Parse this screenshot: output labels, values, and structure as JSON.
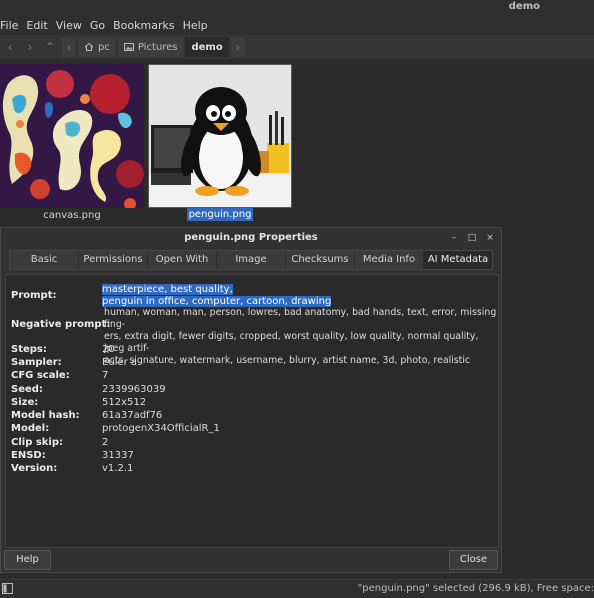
{
  "window": {
    "title": "demo"
  },
  "menubar": {
    "items": [
      "File",
      "Edit",
      "View",
      "Go",
      "Bookmarks",
      "Help"
    ]
  },
  "toolbar": {
    "crumbs": [
      "pc",
      "Pictures",
      "demo"
    ]
  },
  "files": [
    {
      "name": "canvas.png"
    },
    {
      "name": "penguin.png"
    }
  ],
  "dialog": {
    "title": "penguin.png Properties",
    "tabs": [
      "Basic",
      "Permissions",
      "Open With",
      "Image",
      "Checksums",
      "Media Info",
      "AI Metadata"
    ],
    "active_tab": "AI Metadata",
    "fields": {
      "prompt": {
        "label": "Prompt:",
        "line1": "masterpiece, best quality,",
        "line2": "penguin in office, computer, cartoon, drawing"
      },
      "negative": {
        "label": "Negative prompt:",
        "line1": "human, woman, man, person, lowres, bad anatomy, bad hands, text, error, missing fing-",
        "line2": "ers, extra digit, fewer digits, cropped, worst quality, low quality, normal quality, jpeg artif-",
        "line3": "acts, signature, watermark, username, blurry, artist name, 3d, photo, realistic"
      },
      "steps": {
        "label": "Steps:",
        "value": "20"
      },
      "sampler": {
        "label": "Sampler:",
        "value": "Euler a"
      },
      "cfg": {
        "label": "CFG scale:",
        "value": "7"
      },
      "seed": {
        "label": "Seed:",
        "value": "2339963039"
      },
      "size": {
        "label": "Size:",
        "value": "512x512"
      },
      "model_hash": {
        "label": "Model hash:",
        "value": "61a37adf76"
      },
      "model": {
        "label": "Model:",
        "value": "protogenX34OfficialR_1"
      },
      "clip_skip": {
        "label": "Clip skip:",
        "value": "2"
      },
      "ensd": {
        "label": "ENSD:",
        "value": "31337"
      },
      "version": {
        "label": "Version:",
        "value": "v1.2.1"
      }
    },
    "help_label": "Help",
    "close_label": "Close",
    "window_buttons": {
      "minimize": "–",
      "maximize": "□",
      "close": "×"
    }
  },
  "statusbar": {
    "text": "\"penguin.png\" selected (296.9 kB), Free space:"
  },
  "colors": {
    "selection": "#2f6ac0",
    "background": "#2b2b2b"
  }
}
